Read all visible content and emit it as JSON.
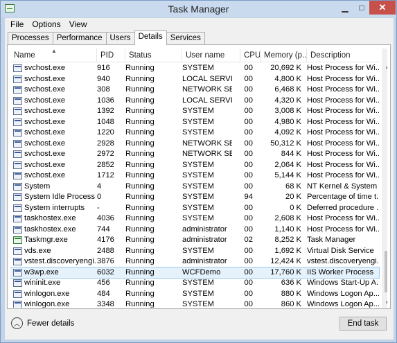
{
  "window": {
    "title": "Task Manager",
    "controls": {
      "minimize": "▁",
      "maximize": "□",
      "close": "✕"
    }
  },
  "menu": {
    "items": [
      "File",
      "Options",
      "View"
    ]
  },
  "tabs": [
    {
      "label": "Processes",
      "active": false
    },
    {
      "label": "Performance",
      "active": false
    },
    {
      "label": "Users",
      "active": false
    },
    {
      "label": "Details",
      "active": true
    },
    {
      "label": "Services",
      "active": false
    }
  ],
  "table": {
    "sort_column": "Name",
    "sort_direction": "ascending",
    "columns": [
      {
        "key": "name",
        "label": "Name"
      },
      {
        "key": "pid",
        "label": "PID"
      },
      {
        "key": "status",
        "label": "Status"
      },
      {
        "key": "user",
        "label": "User name"
      },
      {
        "key": "cpu",
        "label": "CPU"
      },
      {
        "key": "mem",
        "label": "Memory (p..."
      },
      {
        "key": "desc",
        "label": "Description"
      }
    ],
    "selected_index": 19,
    "rows": [
      {
        "name": "svchost.exe",
        "pid": "916",
        "status": "Running",
        "user": "SYSTEM",
        "cpu": "00",
        "mem": "20,692 K",
        "desc": "Host Process for Wi...",
        "icon": "process-icon"
      },
      {
        "name": "svchost.exe",
        "pid": "940",
        "status": "Running",
        "user": "LOCAL SERVICE",
        "cpu": "00",
        "mem": "4,800 K",
        "desc": "Host Process for Wi...",
        "icon": "process-icon"
      },
      {
        "name": "svchost.exe",
        "pid": "308",
        "status": "Running",
        "user": "NETWORK SE...",
        "cpu": "00",
        "mem": "6,468 K",
        "desc": "Host Process for Wi...",
        "icon": "process-icon"
      },
      {
        "name": "svchost.exe",
        "pid": "1036",
        "status": "Running",
        "user": "LOCAL SERVICE",
        "cpu": "00",
        "mem": "4,320 K",
        "desc": "Host Process for Wi...",
        "icon": "process-icon"
      },
      {
        "name": "svchost.exe",
        "pid": "1392",
        "status": "Running",
        "user": "SYSTEM",
        "cpu": "00",
        "mem": "3,008 K",
        "desc": "Host Process for Wi...",
        "icon": "process-icon"
      },
      {
        "name": "svchost.exe",
        "pid": "1048",
        "status": "Running",
        "user": "SYSTEM",
        "cpu": "00",
        "mem": "4,980 K",
        "desc": "Host Process for Wi...",
        "icon": "process-icon"
      },
      {
        "name": "svchost.exe",
        "pid": "1220",
        "status": "Running",
        "user": "SYSTEM",
        "cpu": "00",
        "mem": "4,092 K",
        "desc": "Host Process for Wi...",
        "icon": "process-icon"
      },
      {
        "name": "svchost.exe",
        "pid": "2928",
        "status": "Running",
        "user": "NETWORK SE...",
        "cpu": "00",
        "mem": "50,312 K",
        "desc": "Host Process for Wi...",
        "icon": "process-icon"
      },
      {
        "name": "svchost.exe",
        "pid": "2972",
        "status": "Running",
        "user": "NETWORK SE...",
        "cpu": "00",
        "mem": "844 K",
        "desc": "Host Process for Wi...",
        "icon": "process-icon"
      },
      {
        "name": "svchost.exe",
        "pid": "2852",
        "status": "Running",
        "user": "SYSTEM",
        "cpu": "00",
        "mem": "2,064 K",
        "desc": "Host Process for Wi...",
        "icon": "process-icon"
      },
      {
        "name": "svchost.exe",
        "pid": "1712",
        "status": "Running",
        "user": "SYSTEM",
        "cpu": "00",
        "mem": "5,144 K",
        "desc": "Host Process for Wi...",
        "icon": "process-icon"
      },
      {
        "name": "System",
        "pid": "4",
        "status": "Running",
        "user": "SYSTEM",
        "cpu": "00",
        "mem": "68 K",
        "desc": "NT Kernel & System",
        "icon": "process-icon"
      },
      {
        "name": "System Idle Process",
        "pid": "0",
        "status": "Running",
        "user": "SYSTEM",
        "cpu": "94",
        "mem": "20 K",
        "desc": "Percentage of time t...",
        "icon": "process-icon"
      },
      {
        "name": "System interrupts",
        "pid": "-",
        "status": "Running",
        "user": "SYSTEM",
        "cpu": "00",
        "mem": "0 K",
        "desc": "Deferred procedure ...",
        "icon": "process-icon"
      },
      {
        "name": "taskhostex.exe",
        "pid": "4036",
        "status": "Running",
        "user": "SYSTEM",
        "cpu": "00",
        "mem": "2,608 K",
        "desc": "Host Process for Wi...",
        "icon": "process-icon"
      },
      {
        "name": "taskhostex.exe",
        "pid": "744",
        "status": "Running",
        "user": "administrator",
        "cpu": "00",
        "mem": "1,140 K",
        "desc": "Host Process for Wi...",
        "icon": "process-icon"
      },
      {
        "name": "Taskmgr.exe",
        "pid": "4176",
        "status": "Running",
        "user": "administrator",
        "cpu": "02",
        "mem": "8,252 K",
        "desc": "Task Manager",
        "icon": "task-manager-icon"
      },
      {
        "name": "vds.exe",
        "pid": "2488",
        "status": "Running",
        "user": "SYSTEM",
        "cpu": "00",
        "mem": "1,692 K",
        "desc": "Virtual Disk Service",
        "icon": "process-icon"
      },
      {
        "name": "vstest.discoveryengi...",
        "pid": "3876",
        "status": "Running",
        "user": "administrator",
        "cpu": "00",
        "mem": "12,424 K",
        "desc": "vstest.discoveryengi...",
        "icon": "process-icon"
      },
      {
        "name": "w3wp.exe",
        "pid": "6032",
        "status": "Running",
        "user": "WCFDemo",
        "cpu": "00",
        "mem": "17,760 K",
        "desc": "IIS Worker Process",
        "icon": "process-icon"
      },
      {
        "name": "wininit.exe",
        "pid": "456",
        "status": "Running",
        "user": "SYSTEM",
        "cpu": "00",
        "mem": "636 K",
        "desc": "Windows Start-Up A...",
        "icon": "process-icon"
      },
      {
        "name": "winlogon.exe",
        "pid": "484",
        "status": "Running",
        "user": "SYSTEM",
        "cpu": "00",
        "mem": "880 K",
        "desc": "Windows Logon Ap...",
        "icon": "process-icon"
      },
      {
        "name": "winlogon.exe",
        "pid": "3348",
        "status": "Running",
        "user": "SYSTEM",
        "cpu": "00",
        "mem": "860 K",
        "desc": "Windows Logon Ap...",
        "icon": "process-icon"
      }
    ]
  },
  "footer": {
    "fewer_details": "Fewer details",
    "end_task": "End task"
  },
  "colors": {
    "frame": "#c3d4e9",
    "close_button": "#c7504a",
    "selection_bg": "#e5f1fb",
    "selection_border": "#99c9ef"
  }
}
